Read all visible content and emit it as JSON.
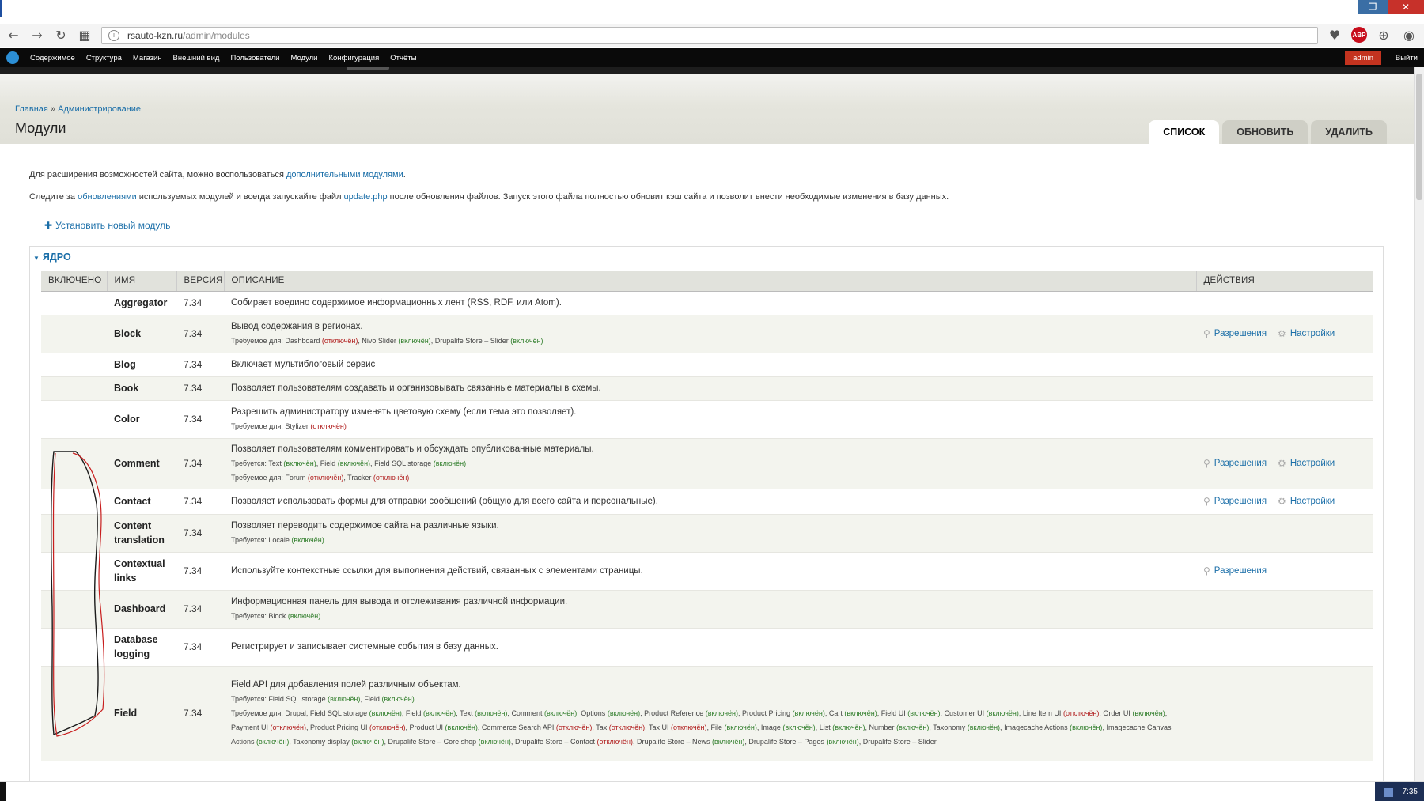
{
  "browser": {
    "url_host": "rsauto-kzn.ru",
    "url_path": "/admin/modules"
  },
  "admin_menu": {
    "items": [
      "Содержимое",
      "Структура",
      "Магазин",
      "Внешний вид",
      "Пользователи",
      "Модули",
      "Конфигурация",
      "Отчёты"
    ],
    "user": "admin",
    "logout": "Выйти"
  },
  "breadcrumb": {
    "home": "Главная",
    "separator": "»",
    "admin": "Администрирование"
  },
  "page_title": "Модули",
  "tabs": [
    {
      "label": "СПИСОК",
      "active": true
    },
    {
      "label": "ОБНОВИТЬ",
      "active": false
    },
    {
      "label": "УДАЛИТЬ",
      "active": false
    }
  ],
  "intro": {
    "p1_before": "Для расширения возможностей сайта, можно воспользоваться ",
    "p1_link": "дополнительными модулями",
    "p1_after": ".",
    "p2_a": "Следите за ",
    "p2_link1": "обновлениями",
    "p2_b": " используемых модулей и всегда запускайте файл ",
    "p2_link2": "update.php",
    "p2_c": " после обновления файлов. Запуск этого файла полностью обновит кэш сайта и позволит внести необходимые изменения в базу данных."
  },
  "install_link": "Установить новый модуль",
  "fieldset_legend": "ЯДРО",
  "table": {
    "headers": [
      "ВКЛЮЧЕНО",
      "ИМЯ",
      "ВЕРСИЯ",
      "ОПИСАНИЕ",
      "ДЕЙСТВИЯ"
    ],
    "permissions_label": "Разрешения",
    "settings_label": "Настройки",
    "required_for": "Требуемое для:",
    "requires": "Требуется:",
    "enabled_word": "(включён)",
    "disabled_word": "(отключён)",
    "rows": [
      {
        "name": "Aggregator",
        "version": "7.34",
        "desc": "Собирает воедино содержимое информационных лент (RSS, RDF, или Atom).",
        "lines": [],
        "perm": false,
        "settings": false
      },
      {
        "name": "Block",
        "version": "7.34",
        "desc": "Вывод содержания в регионах.",
        "lines": [
          {
            "prefix": "Требуемое для:",
            "deps": [
              {
                "n": "Dashboard",
                "s": "off"
              },
              {
                "n": "Nivo Slider",
                "s": "on"
              },
              {
                "n": "Drupalife Store – Slider",
                "s": "on"
              }
            ]
          }
        ],
        "perm": true,
        "settings": true
      },
      {
        "name": "Blog",
        "version": "7.34",
        "desc": "Включает мультиблоговый сервис",
        "lines": [],
        "perm": false,
        "settings": false
      },
      {
        "name": "Book",
        "version": "7.34",
        "desc": "Позволяет пользователям создавать и организовывать связанные материалы в схемы.",
        "lines": [],
        "perm": false,
        "settings": false
      },
      {
        "name": "Color",
        "version": "7.34",
        "desc": "Разрешить администратору изменять цветовую схему (если тема это позволяет).",
        "lines": [
          {
            "prefix": "Требуемое для:",
            "deps": [
              {
                "n": "Stylizer",
                "s": "off"
              }
            ]
          }
        ],
        "perm": false,
        "settings": false
      },
      {
        "name": "Comment",
        "version": "7.34",
        "desc": "Позволяет пользователям комментировать и обсуждать опубликованные материалы.",
        "lines": [
          {
            "prefix": "Требуется:",
            "deps": [
              {
                "n": "Text",
                "s": "on"
              },
              {
                "n": "Field",
                "s": "on"
              },
              {
                "n": "Field SQL storage",
                "s": "on"
              }
            ]
          },
          {
            "prefix": "Требуемое для:",
            "deps": [
              {
                "n": "Forum",
                "s": "off"
              },
              {
                "n": "Tracker",
                "s": "off"
              }
            ]
          }
        ],
        "perm": true,
        "settings": true
      },
      {
        "name": "Contact",
        "version": "7.34",
        "desc": "Позволяет использовать формы для отправки сообщений (общую для всего сайта и персональные).",
        "lines": [],
        "perm": true,
        "settings": true
      },
      {
        "name": "Content translation",
        "version": "7.34",
        "desc": "Позволяет переводить содержимое сайта на различные языки.",
        "lines": [
          {
            "prefix": "Требуется:",
            "deps": [
              {
                "n": "Locale",
                "s": "on"
              }
            ]
          }
        ],
        "perm": false,
        "settings": false
      },
      {
        "name": "Contextual links",
        "version": "7.34",
        "desc": "Используйте контекстные ссылки для выполнения действий, связанных с элементами страницы.",
        "lines": [],
        "perm": true,
        "settings": false
      },
      {
        "name": "Dashboard",
        "version": "7.34",
        "desc": "Информационная панель для вывода и отслеживания различной информации.",
        "lines": [
          {
            "prefix": "Требуется:",
            "deps": [
              {
                "n": "Block",
                "s": "on"
              }
            ]
          }
        ],
        "perm": false,
        "settings": false
      },
      {
        "name": "Database logging",
        "version": "7.34",
        "desc": "Регистрирует и записывает системные события в базу данных.",
        "lines": [],
        "perm": false,
        "settings": false
      },
      {
        "name": "Field",
        "version": "7.34",
        "desc": "Field API для добавления полей различным объектам.",
        "lines": [
          {
            "prefix": "Требуется:",
            "deps": [
              {
                "n": "Field SQL storage",
                "s": "on"
              },
              {
                "n": "Field",
                "s": "on"
              }
            ]
          },
          {
            "prefix": "Требуемое для:",
            "deps": [
              {
                "n": "Drupal",
                "s": ""
              },
              {
                "n": "Field SQL storage",
                "s": "on"
              },
              {
                "n": "Field",
                "s": "on"
              },
              {
                "n": "Text",
                "s": "on"
              },
              {
                "n": "Comment",
                "s": "on"
              },
              {
                "n": "Options",
                "s": "on"
              },
              {
                "n": "Product Reference",
                "s": "on"
              },
              {
                "n": "Product Pricing",
                "s": "on"
              },
              {
                "n": "Cart",
                "s": "on"
              },
              {
                "n": "Field UI",
                "s": "on"
              },
              {
                "n": "Customer UI",
                "s": "on"
              },
              {
                "n": "Line Item UI",
                "s": "off"
              },
              {
                "n": "Order UI",
                "s": "on"
              },
              {
                "n": "Payment UI",
                "s": "off"
              },
              {
                "n": "Product Pricing UI",
                "s": "off"
              },
              {
                "n": "Product UI",
                "s": "on"
              },
              {
                "n": "Commerce Search API",
                "s": "off"
              },
              {
                "n": "Tax",
                "s": "off"
              },
              {
                "n": "Tax UI",
                "s": "off"
              },
              {
                "n": "File",
                "s": "on"
              },
              {
                "n": "Image",
                "s": "on"
              },
              {
                "n": "List",
                "s": "on"
              },
              {
                "n": "Number",
                "s": "on"
              },
              {
                "n": "Taxonomy",
                "s": "on"
              },
              {
                "n": "Imagecache Actions",
                "s": "on"
              },
              {
                "n": "Imagecache Canvas Actions",
                "s": "on"
              },
              {
                "n": "Taxonomy display",
                "s": "on"
              },
              {
                "n": "Drupalife Store – Core shop",
                "s": "on"
              },
              {
                "n": "Drupalife Store – Contact",
                "s": "off"
              },
              {
                "n": "Drupalife Store – News",
                "s": "on"
              },
              {
                "n": "Drupalife Store – Pages",
                "s": "on"
              },
              {
                "n": "Drupalife Store – Slider",
                "s": ""
              }
            ]
          }
        ],
        "perm": false,
        "settings": false
      }
    ]
  },
  "taskbar": {
    "clock": "7:35"
  },
  "colors": {
    "link": "#1a6ea8",
    "enabled": "#2f7d2a",
    "disabled": "#b01c1c",
    "admin_bar": "#0a0a0a",
    "admin_badge": "#c3331f"
  }
}
